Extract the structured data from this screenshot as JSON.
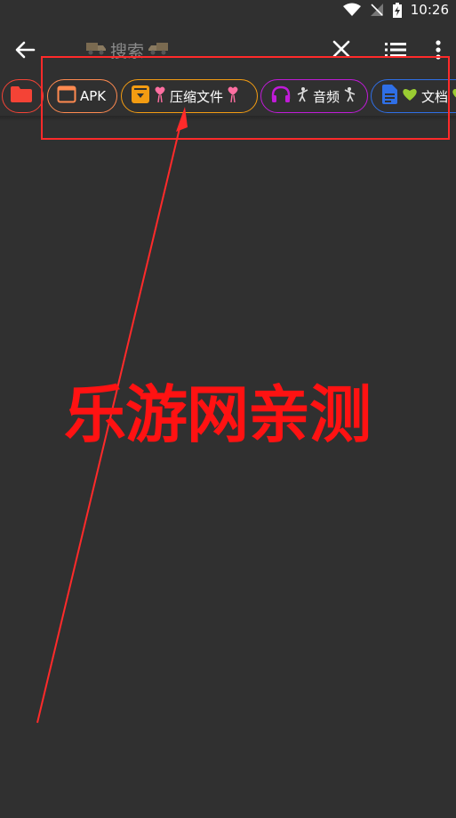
{
  "status": {
    "time": "10:26"
  },
  "appbar": {
    "search_placeholder": "搜索"
  },
  "filters": [
    {
      "label": "",
      "icon": "folder-icon"
    },
    {
      "label": "APK",
      "icon": "window-icon"
    },
    {
      "label": "压缩文件",
      "icon": "archive-icon"
    },
    {
      "label": "音频",
      "icon": "headphones-icon"
    },
    {
      "label": "文档",
      "icon": "document-icon"
    }
  ],
  "watermark": "乐游网亲测",
  "colors": {
    "background": "#303030",
    "folder": "#f44336",
    "apk": "#ff8a50",
    "archive": "#f39c12",
    "audio": "#c01bd8",
    "document": "#2f6fe6",
    "annotation": "#ff2a2a"
  }
}
